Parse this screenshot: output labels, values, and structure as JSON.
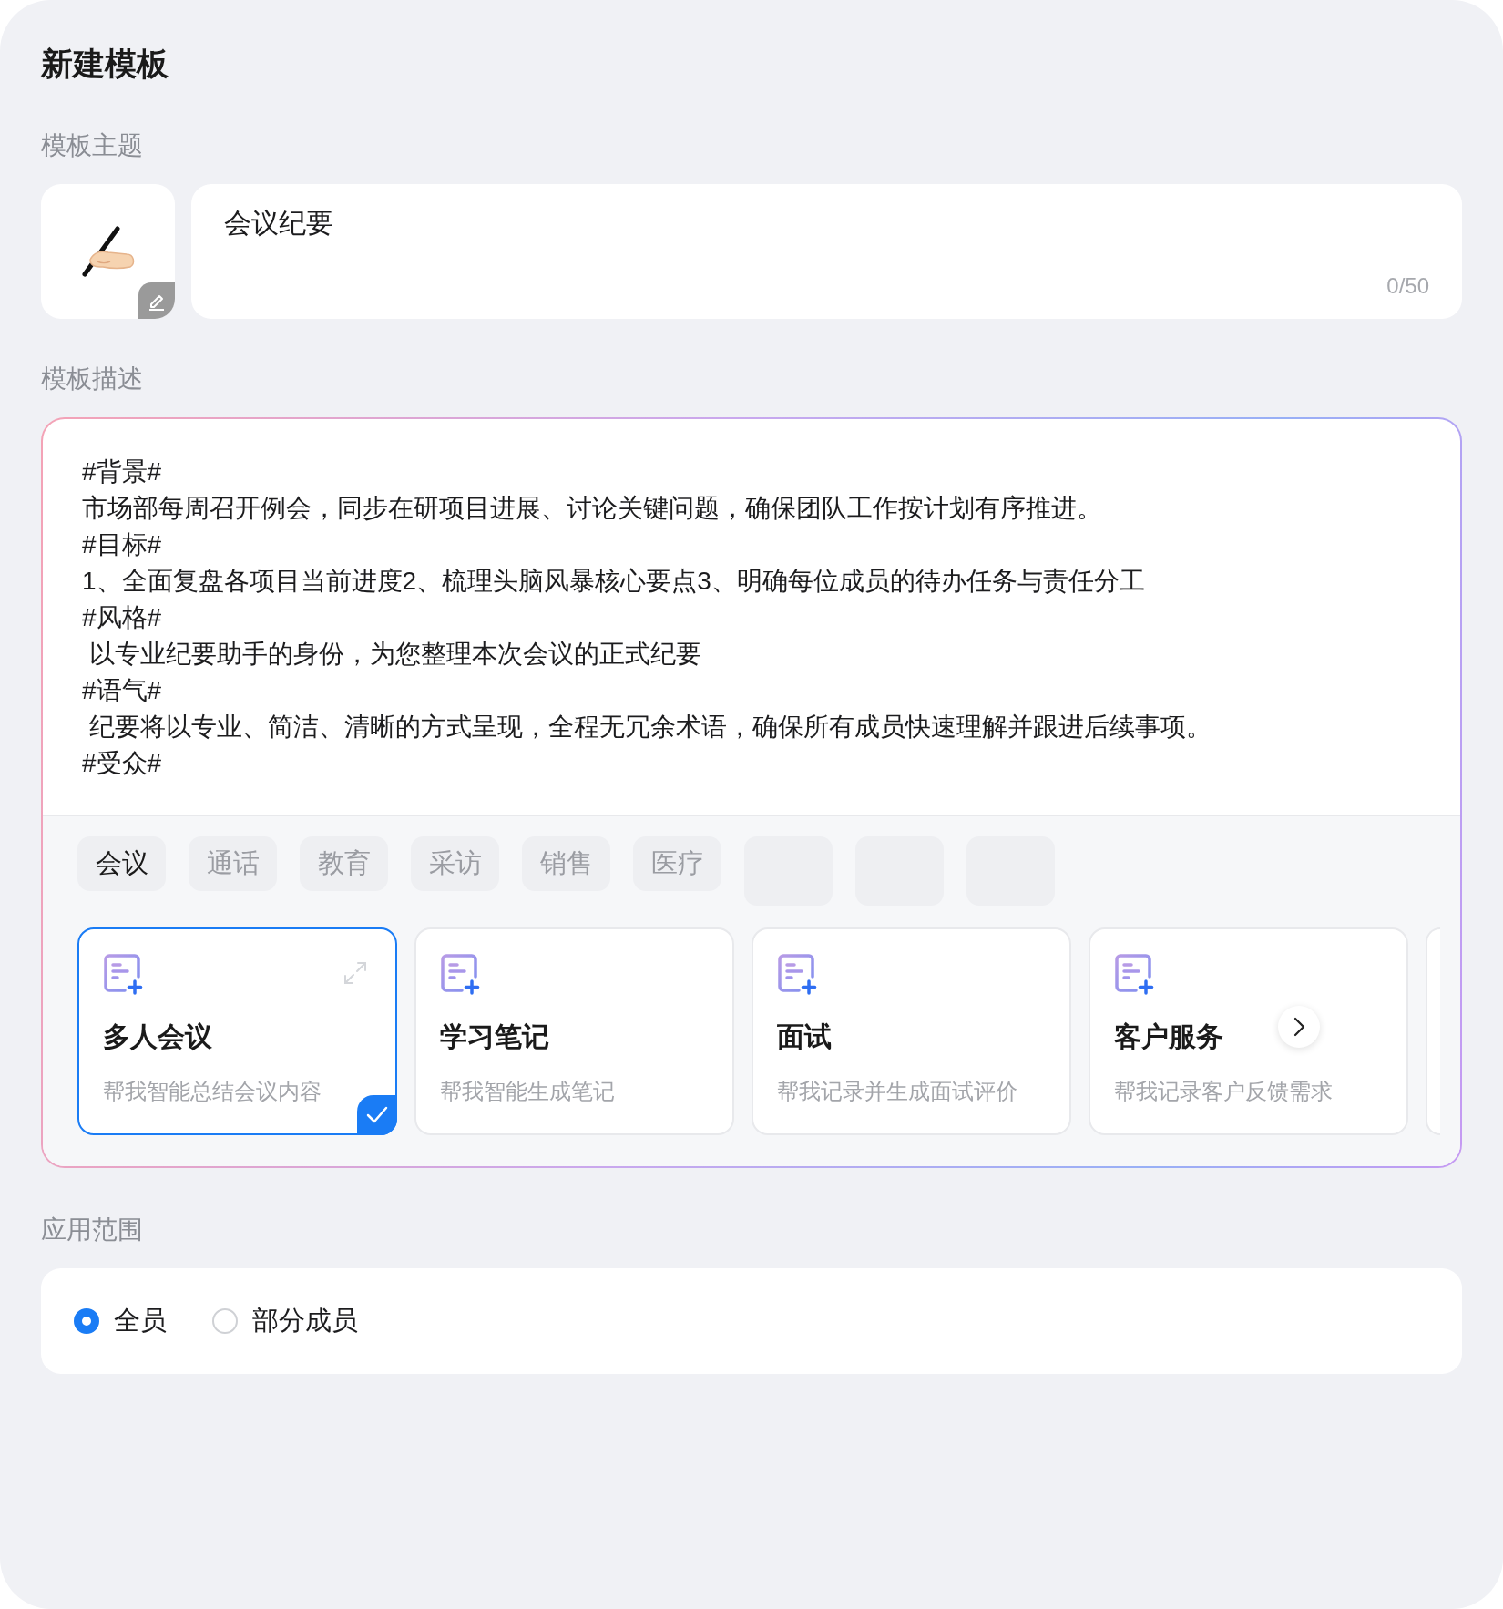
{
  "title": "新建模板",
  "theme": {
    "label": "模板主题",
    "value": "会议纪要",
    "counter": "0/50"
  },
  "description": {
    "label": "模板描述",
    "lines": [
      "#背景#",
      "市场部每周召开例会，同步在研项目进展、讨论关键问题，确保团队工作按计划有序推进。",
      "#目标#",
      "1、全面复盘各项目当前进度2、梳理头脑风暴核心要点3、明确每位成员的待办任务与责任分工",
      "#风格#",
      " 以专业纪要助手的身份，为您整理本次会议的正式纪要",
      "#语气#",
      " 纪要将以专业、简洁、清晰的方式呈现，全程无冗余术语，确保所有成员快速理解并跟进后续事项。",
      "#受众#"
    ],
    "categories": [
      {
        "kind": "text",
        "label": "会议",
        "selected": true
      },
      {
        "kind": "text",
        "label": "通话",
        "selected": false
      },
      {
        "kind": "text",
        "label": "教育",
        "selected": false
      },
      {
        "kind": "text",
        "label": "采访",
        "selected": false
      },
      {
        "kind": "text",
        "label": "销售",
        "selected": false
      },
      {
        "kind": "text",
        "label": "医疗",
        "selected": false
      },
      {
        "kind": "skeleton"
      },
      {
        "kind": "skeleton"
      },
      {
        "kind": "skeleton"
      }
    ],
    "templates": [
      {
        "kind": "full",
        "title": "多人会议",
        "subtitle": "帮我智能总结会议内容",
        "selected": true
      },
      {
        "kind": "full",
        "title": "学习笔记",
        "subtitle": "帮我智能生成笔记",
        "selected": false
      },
      {
        "kind": "full",
        "title": "面试",
        "subtitle": "帮我记录并生成面试评价",
        "selected": false
      },
      {
        "kind": "full",
        "title": "客户服务",
        "subtitle": "帮我记录客户反馈需求",
        "selected": false
      },
      {
        "kind": "partial"
      }
    ]
  },
  "scope": {
    "label": "应用范围",
    "options": [
      {
        "label": "全员",
        "selected": true
      },
      {
        "label": "部分成员",
        "selected": false
      }
    ]
  }
}
